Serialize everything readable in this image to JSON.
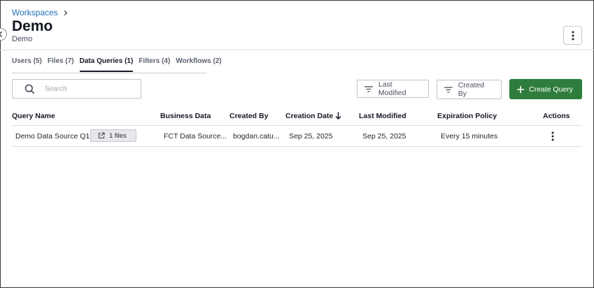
{
  "breadcrumb": {
    "parent": "Workspaces"
  },
  "page": {
    "title": "Demo",
    "subtitle": "Demo"
  },
  "tabs": [
    {
      "label": "Users (5)"
    },
    {
      "label": "Files (7)"
    },
    {
      "label": "Data Queries (1)",
      "active": true
    },
    {
      "label": "Filters (4)"
    },
    {
      "label": "Workflows (2)"
    }
  ],
  "toolbar": {
    "search_placeholder": "Search",
    "last_modified_label": "Last Modified",
    "created_by_label": "Created By",
    "create_label": "Create Query"
  },
  "table": {
    "columns": [
      "Query Name",
      "Business Data",
      "Created By",
      "Creation Date",
      "Last Modified",
      "Expiration Policy",
      "Actions"
    ],
    "sorted_column": "Creation Date",
    "sort_direction": "descending",
    "rows": [
      {
        "query_name": "Demo Data Source Q1",
        "files_badge": "1 files",
        "business_data": "FCT Data Source...",
        "created_by": "bogdan.catu...",
        "creation_date": "Sep 25, 2025",
        "last_modified": "Sep 25, 2025",
        "expiration_policy": "Every 15 minutes"
      }
    ]
  },
  "colors": {
    "accent_green": "#2f7d3c",
    "link_blue": "#1f6fb5"
  },
  "icons": [
    "chevron-left-icon",
    "chevron-right-icon",
    "kebab-menu-icon",
    "search-icon",
    "filter-lines-icon",
    "plus-icon",
    "external-link-icon",
    "sort-down-arrow-icon"
  ]
}
